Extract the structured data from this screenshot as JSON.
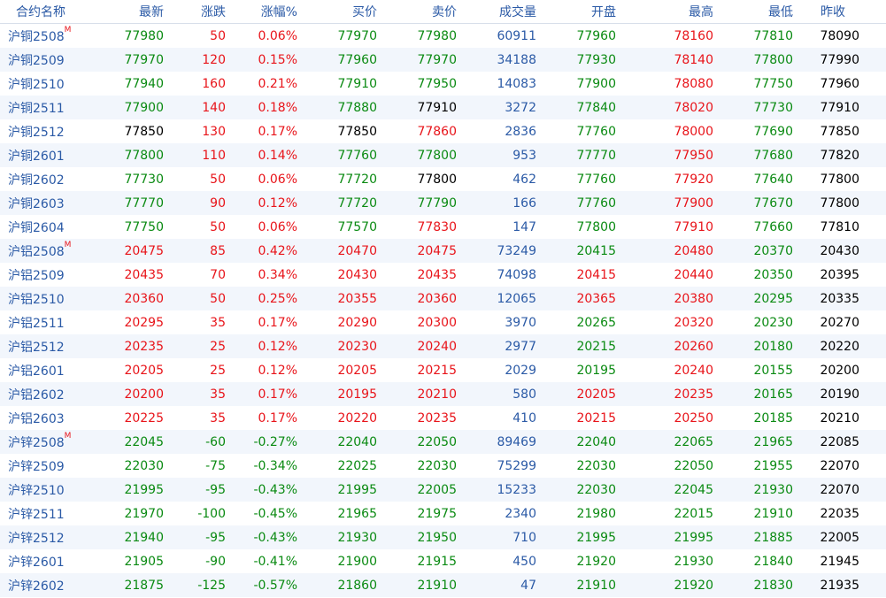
{
  "columns": [
    "合约名称",
    "最新",
    "涨跌",
    "涨幅%",
    "买价",
    "卖价",
    "成交量",
    "开盘",
    "最高",
    "最低",
    "昨收"
  ],
  "main_mark": "M",
  "colors": {
    "up": "#e8141a",
    "down": "#0a8a12",
    "blue_text": "#2b5aa6"
  },
  "rows": [
    {
      "name": "沪铜2508",
      "main": true,
      "last": "77980",
      "chg": "50",
      "pct": "0.06%",
      "bid": "77970",
      "ask": "77980",
      "vol": "60911",
      "open": "77960",
      "high": "78160",
      "low": "77810",
      "prev": "78090"
    },
    {
      "name": "沪铜2509",
      "main": false,
      "last": "77970",
      "chg": "120",
      "pct": "0.15%",
      "bid": "77960",
      "ask": "77970",
      "vol": "34188",
      "open": "77930",
      "high": "78140",
      "low": "77800",
      "prev": "77990"
    },
    {
      "name": "沪铜2510",
      "main": false,
      "last": "77940",
      "chg": "160",
      "pct": "0.21%",
      "bid": "77910",
      "ask": "77950",
      "vol": "14083",
      "open": "77900",
      "high": "78080",
      "low": "77750",
      "prev": "77960"
    },
    {
      "name": "沪铜2511",
      "main": false,
      "last": "77900",
      "chg": "140",
      "pct": "0.18%",
      "bid": "77880",
      "ask": "77910",
      "vol": "3272",
      "open": "77840",
      "high": "78020",
      "low": "77730",
      "prev": "77910"
    },
    {
      "name": "沪铜2512",
      "main": false,
      "last": "77850",
      "chg": "130",
      "pct": "0.17%",
      "bid": "77850",
      "ask": "77860",
      "vol": "2836",
      "open": "77760",
      "high": "78000",
      "low": "77690",
      "prev": "77850"
    },
    {
      "name": "沪铜2601",
      "main": false,
      "last": "77800",
      "chg": "110",
      "pct": "0.14%",
      "bid": "77760",
      "ask": "77800",
      "vol": "953",
      "open": "77770",
      "high": "77950",
      "low": "77680",
      "prev": "77820"
    },
    {
      "name": "沪铜2602",
      "main": false,
      "last": "77730",
      "chg": "50",
      "pct": "0.06%",
      "bid": "77720",
      "ask": "77800",
      "vol": "462",
      "open": "77760",
      "high": "77920",
      "low": "77640",
      "prev": "77800"
    },
    {
      "name": "沪铜2603",
      "main": false,
      "last": "77770",
      "chg": "90",
      "pct": "0.12%",
      "bid": "77720",
      "ask": "77790",
      "vol": "166",
      "open": "77760",
      "high": "77900",
      "low": "77670",
      "prev": "77800"
    },
    {
      "name": "沪铜2604",
      "main": false,
      "last": "77750",
      "chg": "50",
      "pct": "0.06%",
      "bid": "77570",
      "ask": "77830",
      "vol": "147",
      "open": "77800",
      "high": "77910",
      "low": "77660",
      "prev": "77810"
    },
    {
      "name": "沪铝2508",
      "main": true,
      "last": "20475",
      "chg": "85",
      "pct": "0.42%",
      "bid": "20470",
      "ask": "20475",
      "vol": "73249",
      "open": "20415",
      "high": "20480",
      "low": "20370",
      "prev": "20430"
    },
    {
      "name": "沪铝2509",
      "main": false,
      "last": "20435",
      "chg": "70",
      "pct": "0.34%",
      "bid": "20430",
      "ask": "20435",
      "vol": "74098",
      "open": "20415",
      "high": "20440",
      "low": "20350",
      "prev": "20395"
    },
    {
      "name": "沪铝2510",
      "main": false,
      "last": "20360",
      "chg": "50",
      "pct": "0.25%",
      "bid": "20355",
      "ask": "20360",
      "vol": "12065",
      "open": "20365",
      "high": "20380",
      "low": "20295",
      "prev": "20335"
    },
    {
      "name": "沪铝2511",
      "main": false,
      "last": "20295",
      "chg": "35",
      "pct": "0.17%",
      "bid": "20290",
      "ask": "20300",
      "vol": "3970",
      "open": "20265",
      "high": "20320",
      "low": "20230",
      "prev": "20270"
    },
    {
      "name": "沪铝2512",
      "main": false,
      "last": "20235",
      "chg": "25",
      "pct": "0.12%",
      "bid": "20230",
      "ask": "20240",
      "vol": "2977",
      "open": "20215",
      "high": "20260",
      "low": "20180",
      "prev": "20220"
    },
    {
      "name": "沪铝2601",
      "main": false,
      "last": "20205",
      "chg": "25",
      "pct": "0.12%",
      "bid": "20205",
      "ask": "20215",
      "vol": "2029",
      "open": "20195",
      "high": "20240",
      "low": "20155",
      "prev": "20200"
    },
    {
      "name": "沪铝2602",
      "main": false,
      "last": "20200",
      "chg": "35",
      "pct": "0.17%",
      "bid": "20195",
      "ask": "20210",
      "vol": "580",
      "open": "20205",
      "high": "20235",
      "low": "20165",
      "prev": "20190"
    },
    {
      "name": "沪铝2603",
      "main": false,
      "last": "20225",
      "chg": "35",
      "pct": "0.17%",
      "bid": "20220",
      "ask": "20235",
      "vol": "410",
      "open": "20215",
      "high": "20250",
      "low": "20185",
      "prev": "20210"
    },
    {
      "name": "沪锌2508",
      "main": true,
      "last": "22045",
      "chg": "-60",
      "pct": "-0.27%",
      "bid": "22040",
      "ask": "22050",
      "vol": "89469",
      "open": "22040",
      "high": "22065",
      "low": "21965",
      "prev": "22085"
    },
    {
      "name": "沪锌2509",
      "main": false,
      "last": "22030",
      "chg": "-75",
      "pct": "-0.34%",
      "bid": "22025",
      "ask": "22030",
      "vol": "75299",
      "open": "22030",
      "high": "22050",
      "low": "21955",
      "prev": "22070"
    },
    {
      "name": "沪锌2510",
      "main": false,
      "last": "21995",
      "chg": "-95",
      "pct": "-0.43%",
      "bid": "21995",
      "ask": "22005",
      "vol": "15233",
      "open": "22030",
      "high": "22045",
      "low": "21930",
      "prev": "22070"
    },
    {
      "name": "沪锌2511",
      "main": false,
      "last": "21970",
      "chg": "-100",
      "pct": "-0.45%",
      "bid": "21965",
      "ask": "21975",
      "vol": "2340",
      "open": "21980",
      "high": "22015",
      "low": "21910",
      "prev": "22035"
    },
    {
      "name": "沪锌2512",
      "main": false,
      "last": "21940",
      "chg": "-95",
      "pct": "-0.43%",
      "bid": "21930",
      "ask": "21950",
      "vol": "710",
      "open": "21995",
      "high": "21995",
      "low": "21885",
      "prev": "22005"
    },
    {
      "name": "沪锌2601",
      "main": false,
      "last": "21905",
      "chg": "-90",
      "pct": "-0.41%",
      "bid": "21900",
      "ask": "21915",
      "vol": "450",
      "open": "21920",
      "high": "21930",
      "low": "21840",
      "prev": "21945"
    },
    {
      "name": "沪锌2602",
      "main": false,
      "last": "21875",
      "chg": "-125",
      "pct": "-0.57%",
      "bid": "21860",
      "ask": "21910",
      "vol": "47",
      "open": "21910",
      "high": "21920",
      "low": "21830",
      "prev": "21935"
    }
  ]
}
